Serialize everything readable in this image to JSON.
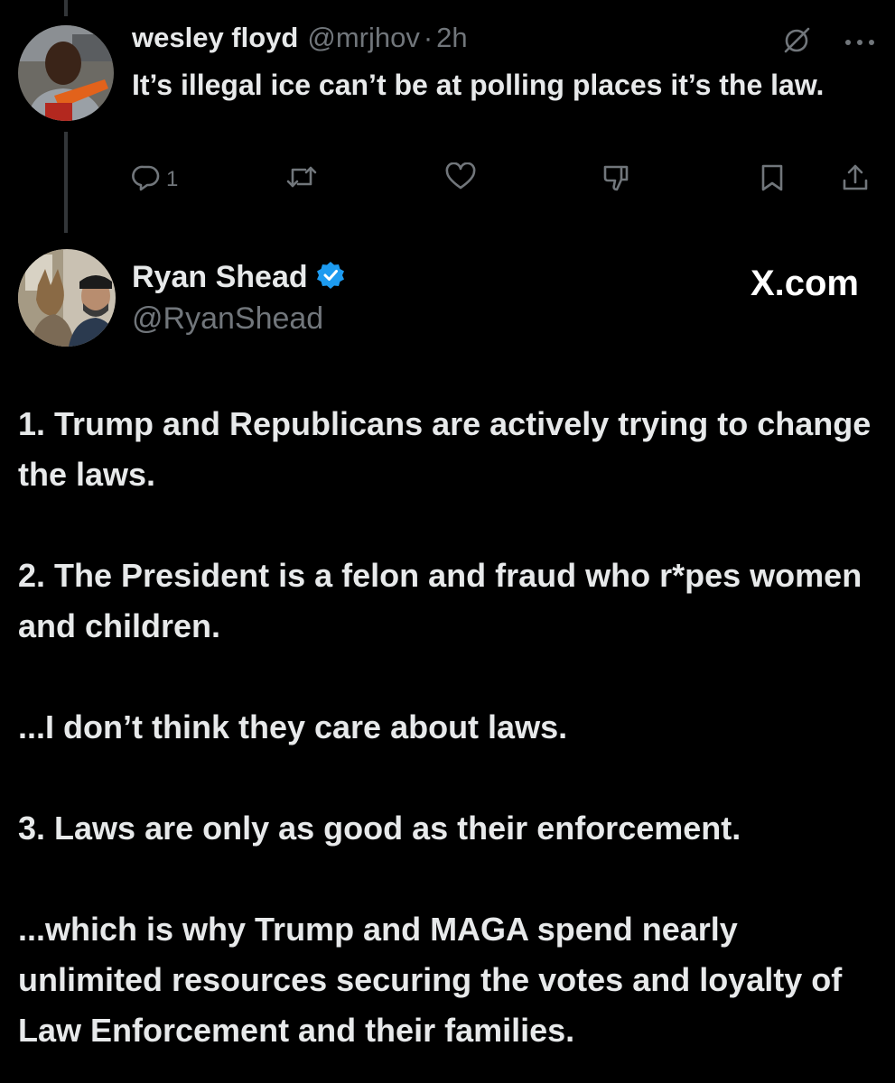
{
  "reply": {
    "author": {
      "name": "wesley floyd",
      "handle": "@mrjhov",
      "separator": "·",
      "time": "2h",
      "avatar_icon": "user-avatar"
    },
    "text": "It’s illegal ice can’t be at polling places it’s the law.",
    "actions": {
      "reply_icon": "reply-icon",
      "reply_count": "1",
      "repost_icon": "repost-icon",
      "like_icon": "heart-icon",
      "dislike_icon": "thumbs-down-icon",
      "bookmark_icon": "bookmark-icon",
      "share_icon": "share-icon"
    },
    "top_icons": [
      "grok-slash-icon",
      "more-icon"
    ]
  },
  "post": {
    "author": {
      "name": "Ryan Shead",
      "handle": "@RyanShead",
      "verified": true,
      "verified_color": "#1d9bf0",
      "avatar_icon": "user-avatar"
    },
    "watermark": "X.com",
    "paragraphs": [
      "1. Trump and Republicans are actively trying to change the laws.",
      "2. The President is a felon and fraud who r*pes women and children.",
      "...I don’t think they care about laws.",
      "3. Laws are only as good as their enforcement.",
      "...which is why Trump and MAGA spend nearly unlimited resources securing the votes and loyalty of Law Enforcement and their families."
    ]
  },
  "colors": {
    "background": "#000000",
    "primary_text": "#e7e9ea",
    "secondary_text": "#71767b",
    "thread_line": "#333639"
  }
}
